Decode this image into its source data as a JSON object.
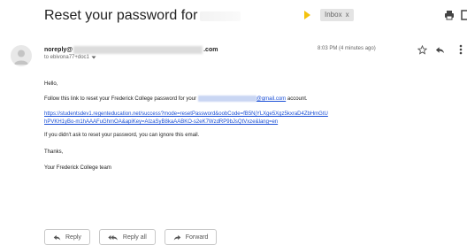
{
  "email": {
    "subject": "Reset your password for",
    "label": "Inbox",
    "label_close": "x",
    "sender": {
      "name": "noreply@",
      "domain": ".com",
      "to": "to ebivona77+doc1"
    },
    "timestamp": "8:03 PM (4 minutes ago)",
    "body": {
      "greeting": "Hello,",
      "follow_text": "Follow this link to reset your Frederick College password for your",
      "follow_email_domain": "@gmail.com",
      "follow_suffix": "account.",
      "link_line1": "https://studentsdev1.regenteducation.net/success?mode=resetPassword&oobCode=fB5NjYLXge5Xgz5kxraD4ZbHmGtU",
      "link_line2": "hPVKH1yBo-m1hAAAFuGhmOA&apiKey=AIzaSyB8kaAABKO-s2eK7WzdRP9bJsQtVxze&lang=en",
      "ignore": "If you didn't ask to reset your password, you can ignore this email.",
      "thanks": "Thanks,",
      "signature": "Your Frederick College team"
    }
  },
  "actions": {
    "reply": "Reply",
    "reply_all": "Reply all",
    "forward": "Forward"
  },
  "icons": {
    "important": "important-marker-icon",
    "print": "print-icon",
    "new_window": "open-in-new-window-icon",
    "star": "star-icon",
    "reply": "reply-icon",
    "more": "more-vert-icon",
    "avatar": "person-icon",
    "dropdown": "chevron-down-icon"
  },
  "colors": {
    "link": "#1a4fd6",
    "important": "#f4c20d",
    "label_bg": "#e4e4e4"
  }
}
